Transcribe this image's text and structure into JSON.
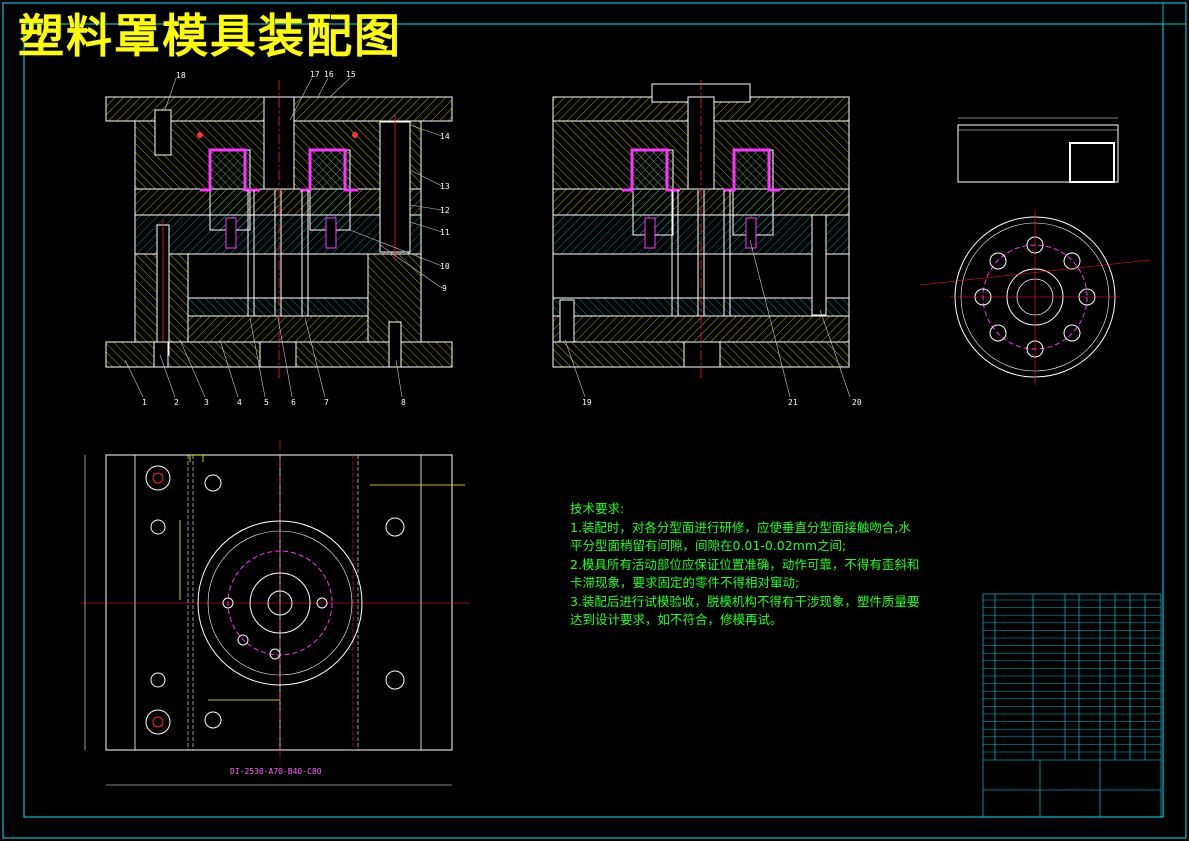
{
  "title": "塑料罩模具装配图",
  "technical_requirements": {
    "heading": "技术要求:",
    "lines": [
      "1.装配时，对各分型面进行研修，应使垂直分型面接触吻合,水",
      "平分型面稍留有间隙，间隙在0.01-0.02mm之间;",
      "2.模具所有活动部位应保证位置准确，动作可靠，不得有歪斜和",
      "卡滞现象，要求固定的零件不得相对窜动;",
      "3.装配后进行试模验收，脱模机构不得有干涉现象，塑件质量要",
      "达到设计要求，如不符合，修模再试。"
    ]
  },
  "part_numbers_front": [
    "1",
    "2",
    "3",
    "4",
    "5",
    "6",
    "7",
    "8",
    "9",
    "10",
    "11",
    "12",
    "13",
    "14",
    "15",
    "16",
    "17",
    "18"
  ],
  "part_numbers_side": [
    "19",
    "20",
    "21"
  ],
  "mold_base_spec": "DI-2530-A70-B40-C80",
  "colors": {
    "background": "#000000",
    "outline": "#ffffff",
    "hatch": "#ffff00",
    "centerline": "#ff2020",
    "dimension": "#ff66ff",
    "leader": "#ffffff",
    "text_green": "#22ff22",
    "frame": "#00e5ff"
  }
}
